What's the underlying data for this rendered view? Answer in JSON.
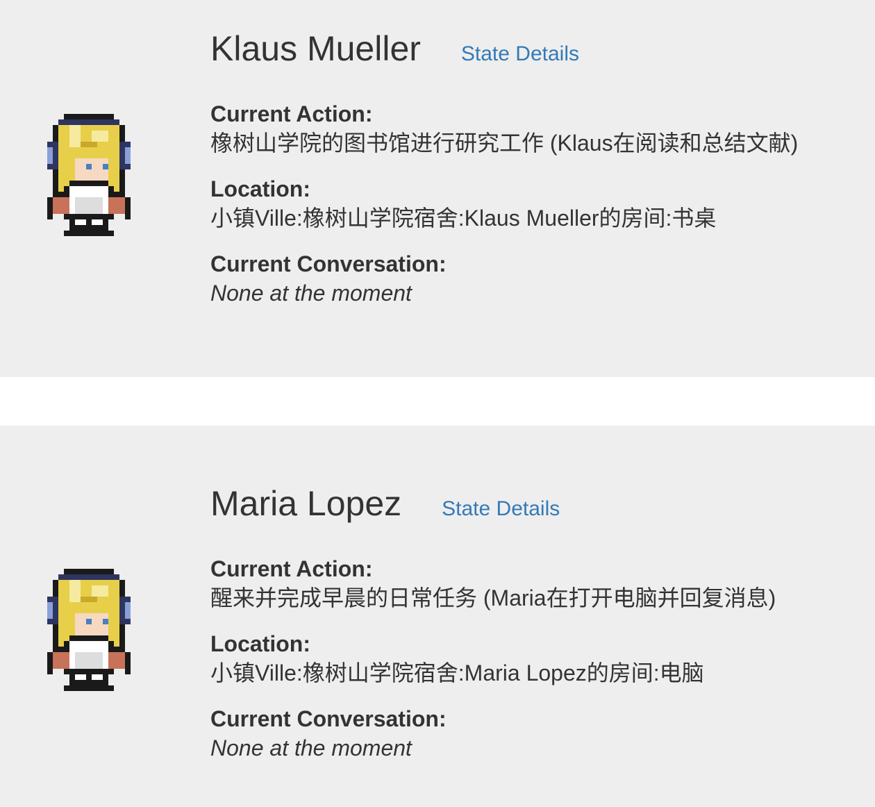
{
  "agents": [
    {
      "name": "Klaus Mueller",
      "state_link": "State Details",
      "current_action_label": "Current Action:",
      "current_action": "橡树山学院的图书馆进行研究工作 (Klaus在阅读和总结文献)",
      "location_label": "Location:",
      "location": "小镇Ville:橡树山学院宿舍:Klaus Mueller的房间:书桌",
      "conversation_label": "Current Conversation:",
      "conversation": "None at the moment"
    },
    {
      "name": "Maria Lopez",
      "state_link": "State Details",
      "current_action_label": "Current Action:",
      "current_action": "醒来并完成早晨的日常任务 (Maria在打开电脑并回复消息)",
      "location_label": "Location:",
      "location": "小镇Ville:橡树山学院宿舍:Maria Lopez的房间:电脑",
      "conversation_label": "Current Conversation:",
      "conversation": "None at the moment"
    }
  ],
  "colors": {
    "card_background": "#eeeeee",
    "link": "#337ab7",
    "text": "#333333"
  },
  "icons": {
    "avatar": "pixel-art-character-sprite"
  }
}
